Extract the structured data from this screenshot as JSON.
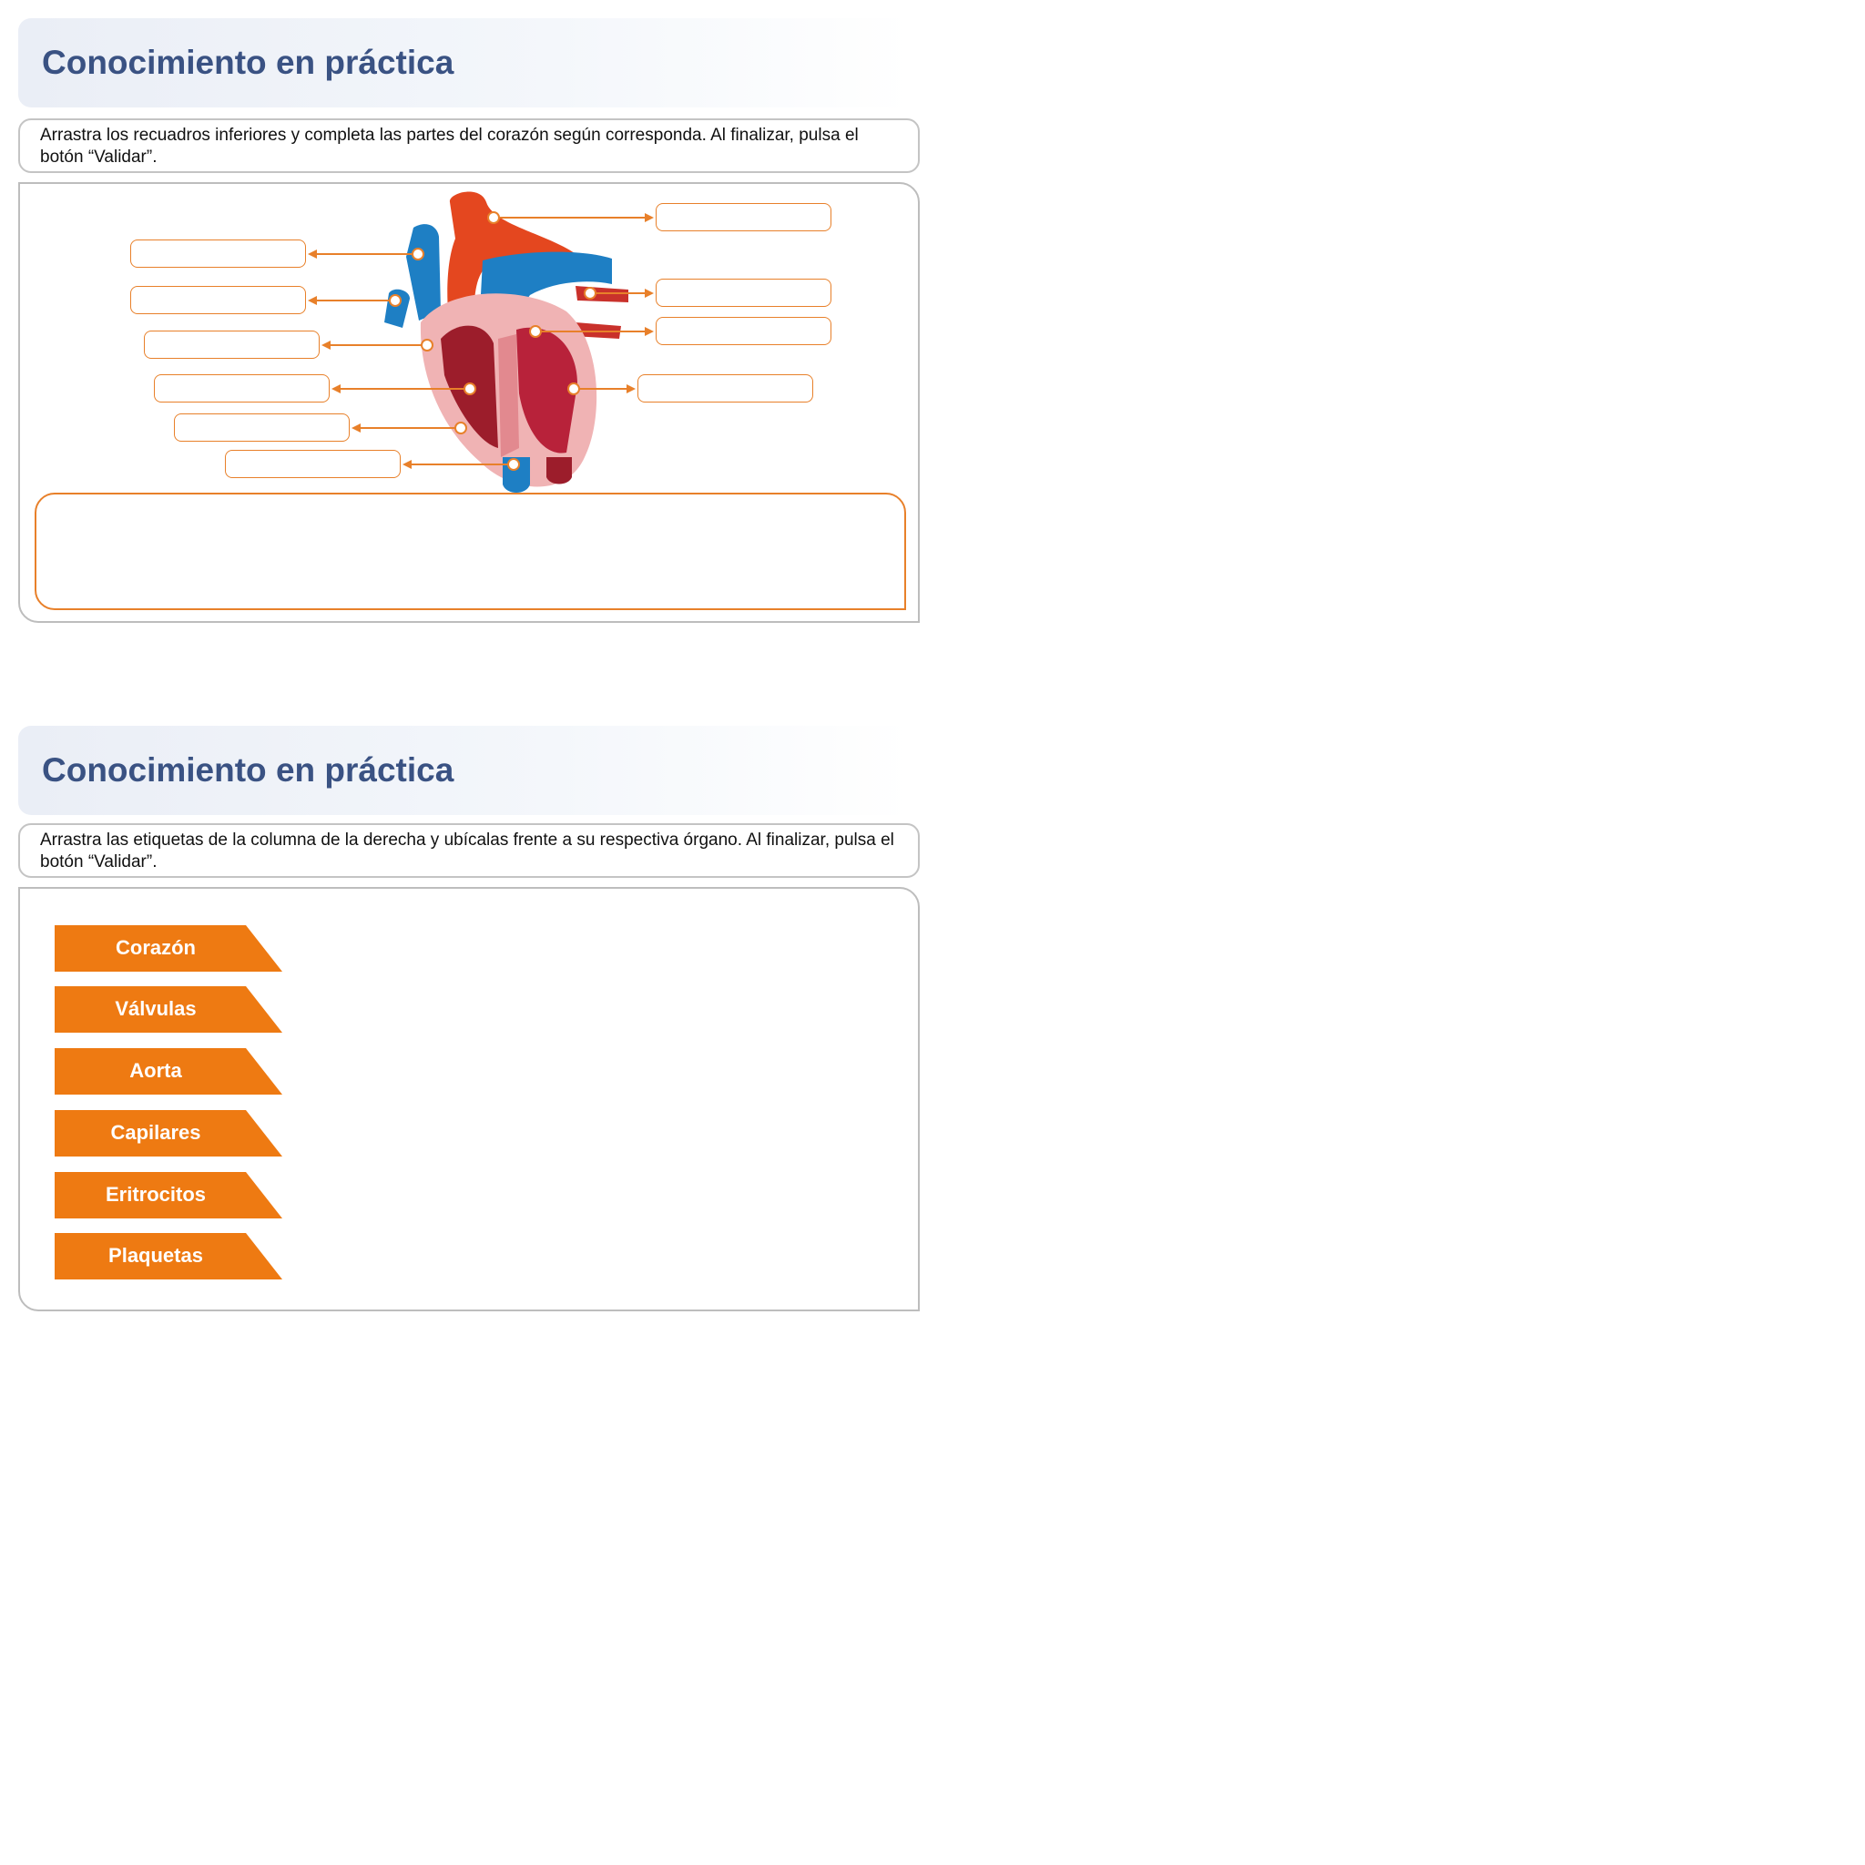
{
  "section1": {
    "title": "Conocimiento en práctica",
    "instruction": "Arrastra los recuadros inferiores y completa las partes del corazón según corresponda. Al finalizar, pulsa el botón “Validar”."
  },
  "section2": {
    "title": "Conocimiento en práctica",
    "instruction": "Arrastra las etiquetas de la columna de la derecha y ubícalas frente a su respectiva órgano. Al finalizar, pulsa el botón “Validar”.",
    "tags": [
      {
        "label": "Corazón"
      },
      {
        "label": "Válvulas"
      },
      {
        "label": "Aorta"
      },
      {
        "label": "Capilares"
      },
      {
        "label": "Eritrocitos"
      },
      {
        "label": "Plaquetas"
      }
    ]
  },
  "colors": {
    "accent": "#ee7a12",
    "title": "#3a5283",
    "border": "#bdbdbd"
  }
}
